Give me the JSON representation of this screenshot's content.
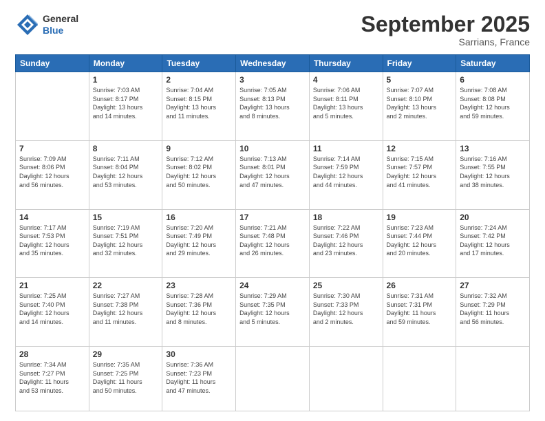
{
  "header": {
    "logo_general": "General",
    "logo_blue": "Blue",
    "title": "September 2025",
    "subtitle": "Sarrians, France"
  },
  "days_of_week": [
    "Sunday",
    "Monday",
    "Tuesday",
    "Wednesday",
    "Thursday",
    "Friday",
    "Saturday"
  ],
  "weeks": [
    [
      {
        "day": "",
        "info": ""
      },
      {
        "day": "1",
        "info": "Sunrise: 7:03 AM\nSunset: 8:17 PM\nDaylight: 13 hours\nand 14 minutes."
      },
      {
        "day": "2",
        "info": "Sunrise: 7:04 AM\nSunset: 8:15 PM\nDaylight: 13 hours\nand 11 minutes."
      },
      {
        "day": "3",
        "info": "Sunrise: 7:05 AM\nSunset: 8:13 PM\nDaylight: 13 hours\nand 8 minutes."
      },
      {
        "day": "4",
        "info": "Sunrise: 7:06 AM\nSunset: 8:11 PM\nDaylight: 13 hours\nand 5 minutes."
      },
      {
        "day": "5",
        "info": "Sunrise: 7:07 AM\nSunset: 8:10 PM\nDaylight: 13 hours\nand 2 minutes."
      },
      {
        "day": "6",
        "info": "Sunrise: 7:08 AM\nSunset: 8:08 PM\nDaylight: 12 hours\nand 59 minutes."
      }
    ],
    [
      {
        "day": "7",
        "info": "Sunrise: 7:09 AM\nSunset: 8:06 PM\nDaylight: 12 hours\nand 56 minutes."
      },
      {
        "day": "8",
        "info": "Sunrise: 7:11 AM\nSunset: 8:04 PM\nDaylight: 12 hours\nand 53 minutes."
      },
      {
        "day": "9",
        "info": "Sunrise: 7:12 AM\nSunset: 8:02 PM\nDaylight: 12 hours\nand 50 minutes."
      },
      {
        "day": "10",
        "info": "Sunrise: 7:13 AM\nSunset: 8:01 PM\nDaylight: 12 hours\nand 47 minutes."
      },
      {
        "day": "11",
        "info": "Sunrise: 7:14 AM\nSunset: 7:59 PM\nDaylight: 12 hours\nand 44 minutes."
      },
      {
        "day": "12",
        "info": "Sunrise: 7:15 AM\nSunset: 7:57 PM\nDaylight: 12 hours\nand 41 minutes."
      },
      {
        "day": "13",
        "info": "Sunrise: 7:16 AM\nSunset: 7:55 PM\nDaylight: 12 hours\nand 38 minutes."
      }
    ],
    [
      {
        "day": "14",
        "info": "Sunrise: 7:17 AM\nSunset: 7:53 PM\nDaylight: 12 hours\nand 35 minutes."
      },
      {
        "day": "15",
        "info": "Sunrise: 7:19 AM\nSunset: 7:51 PM\nDaylight: 12 hours\nand 32 minutes."
      },
      {
        "day": "16",
        "info": "Sunrise: 7:20 AM\nSunset: 7:49 PM\nDaylight: 12 hours\nand 29 minutes."
      },
      {
        "day": "17",
        "info": "Sunrise: 7:21 AM\nSunset: 7:48 PM\nDaylight: 12 hours\nand 26 minutes."
      },
      {
        "day": "18",
        "info": "Sunrise: 7:22 AM\nSunset: 7:46 PM\nDaylight: 12 hours\nand 23 minutes."
      },
      {
        "day": "19",
        "info": "Sunrise: 7:23 AM\nSunset: 7:44 PM\nDaylight: 12 hours\nand 20 minutes."
      },
      {
        "day": "20",
        "info": "Sunrise: 7:24 AM\nSunset: 7:42 PM\nDaylight: 12 hours\nand 17 minutes."
      }
    ],
    [
      {
        "day": "21",
        "info": "Sunrise: 7:25 AM\nSunset: 7:40 PM\nDaylight: 12 hours\nand 14 minutes."
      },
      {
        "day": "22",
        "info": "Sunrise: 7:27 AM\nSunset: 7:38 PM\nDaylight: 12 hours\nand 11 minutes."
      },
      {
        "day": "23",
        "info": "Sunrise: 7:28 AM\nSunset: 7:36 PM\nDaylight: 12 hours\nand 8 minutes."
      },
      {
        "day": "24",
        "info": "Sunrise: 7:29 AM\nSunset: 7:35 PM\nDaylight: 12 hours\nand 5 minutes."
      },
      {
        "day": "25",
        "info": "Sunrise: 7:30 AM\nSunset: 7:33 PM\nDaylight: 12 hours\nand 2 minutes."
      },
      {
        "day": "26",
        "info": "Sunrise: 7:31 AM\nSunset: 7:31 PM\nDaylight: 11 hours\nand 59 minutes."
      },
      {
        "day": "27",
        "info": "Sunrise: 7:32 AM\nSunset: 7:29 PM\nDaylight: 11 hours\nand 56 minutes."
      }
    ],
    [
      {
        "day": "28",
        "info": "Sunrise: 7:34 AM\nSunset: 7:27 PM\nDaylight: 11 hours\nand 53 minutes."
      },
      {
        "day": "29",
        "info": "Sunrise: 7:35 AM\nSunset: 7:25 PM\nDaylight: 11 hours\nand 50 minutes."
      },
      {
        "day": "30",
        "info": "Sunrise: 7:36 AM\nSunset: 7:23 PM\nDaylight: 11 hours\nand 47 minutes."
      },
      {
        "day": "",
        "info": ""
      },
      {
        "day": "",
        "info": ""
      },
      {
        "day": "",
        "info": ""
      },
      {
        "day": "",
        "info": ""
      }
    ]
  ]
}
